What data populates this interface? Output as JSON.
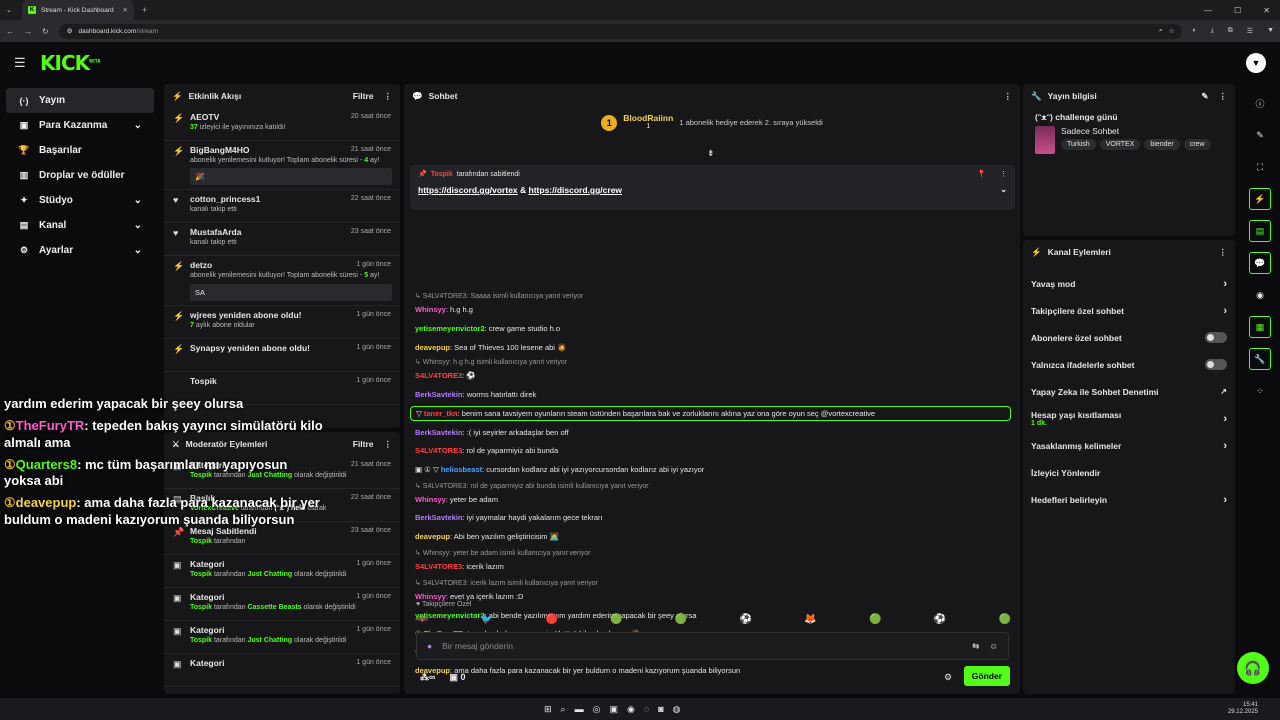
{
  "browser": {
    "tab_title": "Stream - Kick Dashboard",
    "url_host": "dashboard.kick.com",
    "url_path": "/stream"
  },
  "header": {
    "logo": "KICK",
    "logo_badge": "BETA"
  },
  "sidebar": {
    "items": [
      {
        "label": "Yayın",
        "icon": "broadcast-icon",
        "active": true,
        "chevron": false
      },
      {
        "label": "Para Kazanma",
        "icon": "wallet-icon",
        "chevron": true
      },
      {
        "label": "Başarılar",
        "icon": "trophy-icon",
        "chevron": false
      },
      {
        "label": "Droplar ve ödüller",
        "icon": "gift-icon",
        "chevron": false
      },
      {
        "label": "Stüdyo",
        "icon": "studio-icon",
        "chevron": true
      },
      {
        "label": "Kanal",
        "icon": "channel-icon",
        "chevron": true
      },
      {
        "label": "Ayarlar",
        "icon": "gear-icon",
        "chevron": true
      }
    ]
  },
  "activity": {
    "title": "Etkinlik Akışı",
    "filter": "Filtre",
    "items": [
      {
        "icon": "⚡",
        "name": "AEOTV",
        "time": "20 saat önce",
        "sub_prefix": "37",
        "sub": " izleyici ile yayınınıza katıldı!"
      },
      {
        "icon": "⚡",
        "name": "BigBangM4HO",
        "time": "21 saat önce",
        "sub": "abonelik yenilemesini kutluyor! Toplam abonelik süresi - ",
        "sub_green": "4",
        "sub_after": " ay!",
        "msg": "🎉"
      },
      {
        "icon": "♥",
        "name": "cotton_princess1",
        "time": "22 saat önce",
        "sub": "kanalı takip etti"
      },
      {
        "icon": "♥",
        "name": "MustafaArda",
        "time": "23 saat önce",
        "sub": "kanalı takip etti"
      },
      {
        "icon": "⚡",
        "name": "detzo",
        "time": "1 gün önce",
        "sub": "abonelik yenilemesini kutluyor! Toplam abonelik süresi - ",
        "sub_green": "5",
        "sub_after": " ay!",
        "msg": "SA"
      },
      {
        "icon": "⚡",
        "name": "wjrees yeniden abone oldu!",
        "time": "1 gün önce",
        "sub_prefix": "7",
        "sub": " aylık abone oldular"
      },
      {
        "icon": "⚡",
        "name": "Synapsy yeniden abone oldu!",
        "time": "1 gün önce",
        "sub": ""
      },
      {
        "icon": "",
        "name": "Tospik",
        "time": "1 gün önce",
        "sub": ""
      }
    ]
  },
  "mod": {
    "title": "Moderatör Eylemleri",
    "filter": "Filtre",
    "items": [
      {
        "icon": "▣",
        "name": "Kategori",
        "time": "21 saat önce",
        "who": "Tospik",
        "mid": " tarafından ",
        "green": "Just Chatting",
        "after": " olarak değiştirildi"
      },
      {
        "icon": "▤",
        "name": "Başlık",
        "time": "22 saat önce",
        "who": "VortexCreative",
        "mid": " tarafından ",
        "white": "(ᵔᴥᵔ) helö",
        "after": " olarak"
      },
      {
        "icon": "📌",
        "name": "Mesaj Sabitlendi",
        "time": "23 saat önce",
        "who": "Tospik",
        "mid": " tarafından",
        "green": "",
        "after": ""
      },
      {
        "icon": "▣",
        "name": "Kategori",
        "time": "1 gün önce",
        "who": "Tospik",
        "mid": " tarafından ",
        "green": "Just Chatting",
        "after": " olarak değiştirildi"
      },
      {
        "icon": "▣",
        "name": "Kategori",
        "time": "1 gün önce",
        "who": "Tospik",
        "mid": " tarafından ",
        "green": "Cassette Beasts",
        "after": " olarak değiştirildi"
      },
      {
        "icon": "▣",
        "name": "Kategori",
        "time": "1 gün önce",
        "who": "Tospik",
        "mid": " tarafından ",
        "green": "Just Chatting",
        "after": " olarak değiştirildi"
      },
      {
        "icon": "▣",
        "name": "Kategori",
        "time": "1 gün önce",
        "who": "",
        "mid": "",
        "green": "",
        "after": ""
      }
    ]
  },
  "chat": {
    "title": "Sohbet",
    "gift_user": "BloodRaiinn",
    "gift_count": "1",
    "gift_text": "1 abonelik hediye ederek 2. sıraya yükseldi",
    "pinned_by": "Tospik",
    "pinned_label": "tarafından sabitlendi",
    "pinned_link1": "https://discord.gg/vortex",
    "pinned_amp": " & ",
    "pinned_link2": "https://discord.gg/crew",
    "messages": [
      {
        "reply": "↳ S4LV4TORE3: Saaaa isimli kullanıcıya yanıt veriyor"
      },
      {
        "user": "Whinsyy",
        "color": "#ff5acd",
        "text": ": h.g h.g"
      },
      {
        "user": "yetisemeyenvictor2",
        "color": "#53fc18",
        "text": ": crew game studio h.o"
      },
      {
        "user": "deavepup",
        "color": "#f5d442",
        "text": ": Sea of Thieves 100 lesene abi 🧔"
      },
      {
        "reply": "↳ Whinsyy: h.g h.g isimli kullanıcıya yanıt veriyor"
      },
      {
        "user": "S4LV4TORE3",
        "color": "#ff4040",
        "text": ": ⚽"
      },
      {
        "user": "BerkSavtekin",
        "color": "#b57bff",
        "text": ": worms hatırlattı direk"
      },
      {
        "user": "taner_tkn",
        "color": "#ff4040",
        "text": ": benim sana tavsiyem oyunların steam üstünden başarılara bak ve zorluklarını aklına yaz ona göre oyun seç @vortexcreative",
        "highlight": true
      },
      {
        "user": "BerkSavtekin",
        "color": "#b57bff",
        "text": ": :( iyi seyirler arkadaşlar ben off"
      },
      {
        "user": "S4LV4TORE3",
        "color": "#ff4040",
        "text": ": rol de yaparmiyiz abi bunda"
      },
      {
        "user": "heliosbeast",
        "color": "#4aa3ff",
        "text": ": cursordan kodlanz abi iyi yazıyorcursordan kodlarız abi iyi yazıyor",
        "badges": true
      },
      {
        "reply": "↳ S4LV4TORE3: rol de yaparmiyiz abi bunda isimli kullanıcıya yanıt veriyor"
      },
      {
        "user": "Whinsyy",
        "color": "#ff5acd",
        "text": ": yeter be adam"
      },
      {
        "user": "BerkSavtekin",
        "color": "#b57bff",
        "text": ": iyi yaymalar haydi yakalarım gece tekrarı"
      },
      {
        "user": "deavepup",
        "color": "#f5d442",
        "text": ": Abi ben yazılım geliştiricisim 🧑‍💻"
      },
      {
        "reply": "↳ Whinsyy: yeter be adam isimli kullanıcıya yanıt veriyor"
      },
      {
        "user": "S4LV4TORE3",
        "color": "#ff4040",
        "text": ": icerik lazım"
      },
      {
        "reply": "↳ S4LV4TORE3: icerik lazım isimli kullanıcıya yanıt veriyor"
      },
      {
        "user": "Whinsyy",
        "color": "#ff5acd",
        "text": ": evet ya içerik lazım :D"
      },
      {
        "user": "yetisemeyenvictor2",
        "color": "#53fc18",
        "text": ": abi bende yazılımcıyım yardım ederim yapacak bir şeey olursa"
      },
      {
        "user": "TheFuryTR",
        "color": "#ff5acd",
        "text": ": tepeden bakış yayıncı simülatörü kilo almalı ama 🧔",
        "coin": true
      },
      {
        "user": "Quarters8",
        "color": "#53fc18",
        "text": ": mc tüm başarımlar mı yapıyosun yoksa abi",
        "coin": true
      },
      {
        "user": "deavepup",
        "color": "#f5d442",
        "text": ": ama daha fazla para kazanacak bir yer buldum o madeni kazıyorum şuanda biliyorsun"
      }
    ],
    "followers_only": "Takipçilere Özel",
    "input_placeholder": "Bir mesaj gönderin",
    "points": "0",
    "send": "Gönder"
  },
  "stream_info": {
    "title": "Yayın bilgisi",
    "stream_title": "(ᵔᴥᵔ) challenge günü",
    "category": "Sadece Sohbet",
    "tags": [
      "Turkish",
      "VORTEX",
      "biender",
      "crew"
    ]
  },
  "channel_actions": {
    "title": "Kanal Eylemleri",
    "items": [
      {
        "label": "Yavaş mod",
        "ctl": "chevron"
      },
      {
        "label": "Takipçilere özel sohbet",
        "ctl": "chevron"
      },
      {
        "label": "Abonelere özel sohbet",
        "ctl": "toggle"
      },
      {
        "label": "Yalnızca ifadelerle sohbet",
        "ctl": "toggle"
      },
      {
        "label": "Yapay Zeka ile Sohbet Denetimi",
        "ctl": "ext"
      },
      {
        "label": "Hesap yaşı kısıtlaması",
        "sub": "1 dk.",
        "ctl": "chevron"
      },
      {
        "label": "Yasaklanmış kelimeler",
        "ctl": "chevron"
      },
      {
        "label": "İzleyici Yönlendir",
        "ctl": ""
      },
      {
        "label": "Hedefleri belirleyin",
        "ctl": "chevron"
      }
    ]
  },
  "overlay": {
    "lines": [
      {
        "text": "yardım ederim yapacak bir şeey olursa"
      },
      {
        "user": "TheFuryTR",
        "color": "#ff5acd",
        "text": ": tepeden bakış yayıncı simülatörü kilo almalı ama"
      },
      {
        "user": "Quarters8",
        "color": "#53fc18",
        "text": ": mc tüm başarımlar mı yapıyosun yoksa abi"
      },
      {
        "user": "deavepup",
        "color": "#f5d442",
        "text": ": ama daha fazla para kazanacak bir yer buldum o madeni kazıyorum şuanda biliyorsun"
      }
    ]
  },
  "taskbar": {
    "time": "15:41",
    "date": "29.12.2025"
  }
}
